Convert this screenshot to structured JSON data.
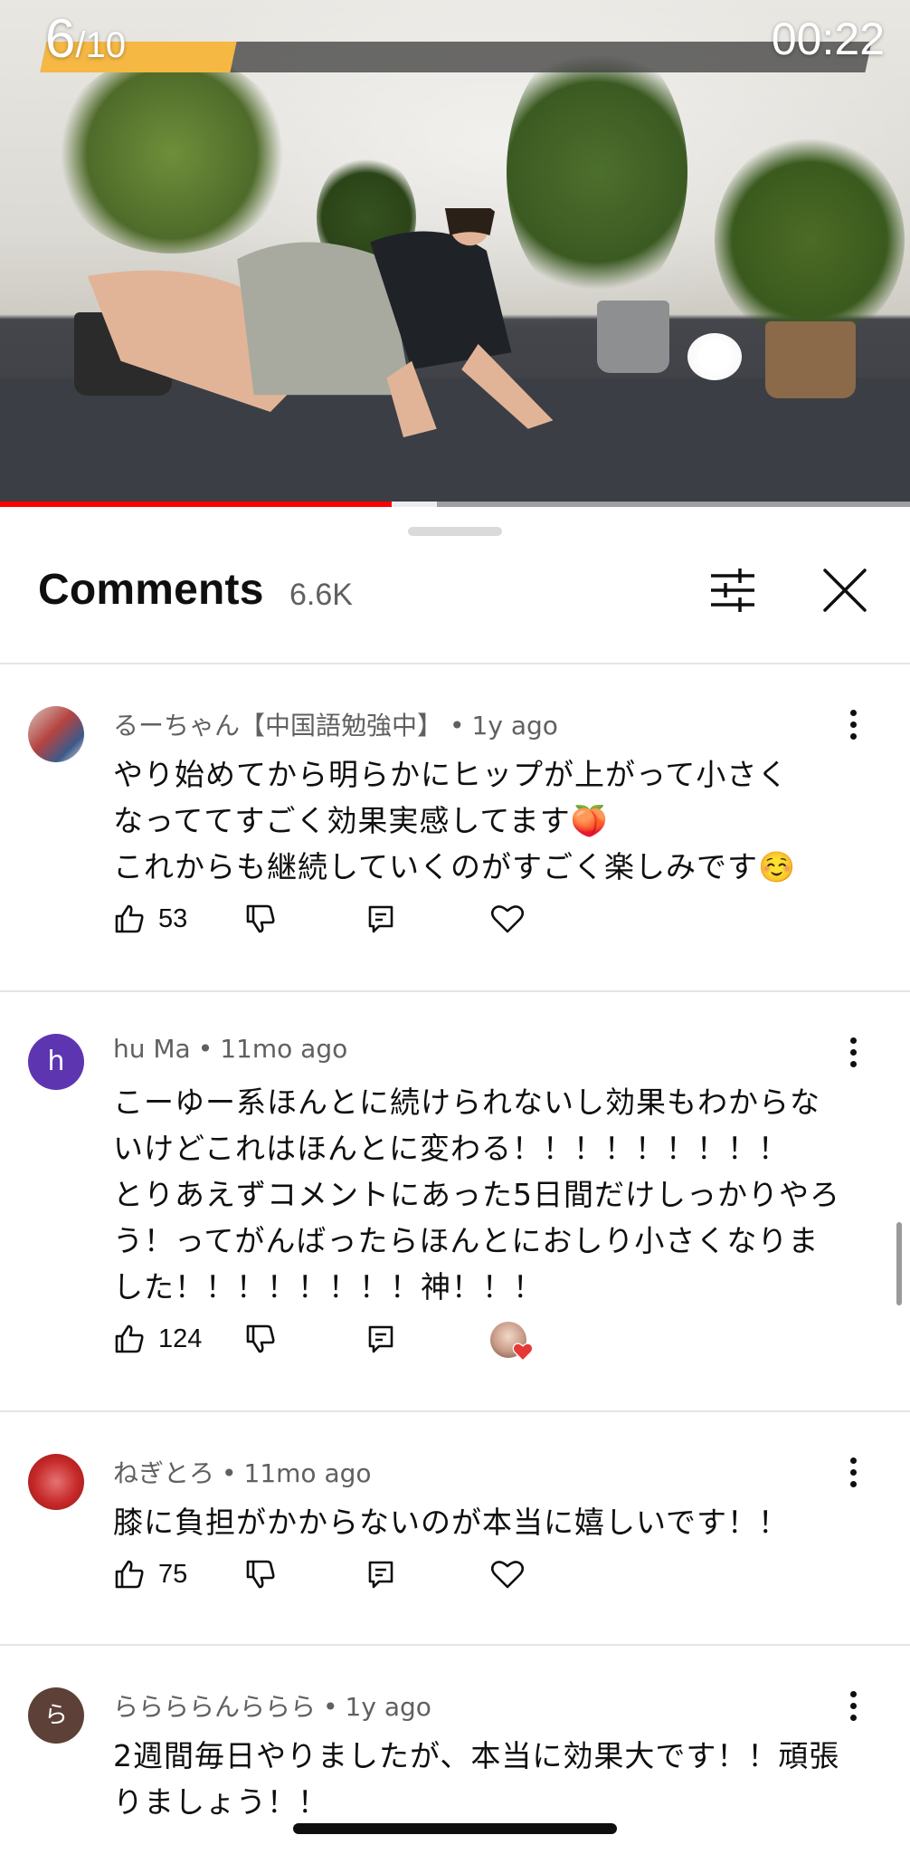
{
  "video": {
    "set_current": "6",
    "set_total": "/10",
    "timer": "00:22",
    "set_progress_fraction": 0.23,
    "playback_progress_fraction": 0.43,
    "buffered_fraction": 0.05
  },
  "sheet": {
    "title": "Comments",
    "count": "6.6K"
  },
  "comments": [
    {
      "author": "るーちゃん【中国語勉強中】",
      "time": "1y ago",
      "lines": [
        "やり始めてから明らかにヒップが上がって小さく",
        "なっててすごく効果実感してます🍑",
        "これからも継続していくのがすごく楽しみです☺️"
      ],
      "likes": "53",
      "avatar_color": "#8a6b6b",
      "avatar_letter": "",
      "creator_hearted": false
    },
    {
      "author": "hu Ma",
      "time": "11mo ago",
      "lines": [
        "こーゆー系ほんとに続けられないし効果もわからな",
        "いけどこれはほんとに変わる！！！！！！！！！",
        "とりあえずコメントにあった5日間だけしっかりやろ",
        "う！ってがんばったらほんとにおしり小さくなりま",
        "した！！！！！！！！神！！！"
      ],
      "likes": "124",
      "avatar_color": "#5e35b1",
      "avatar_letter": "h",
      "creator_hearted": true
    },
    {
      "author": "ねぎとろ",
      "time": "11mo ago",
      "lines": [
        "膝に負担がかからないのが本当に嬉しいです！！"
      ],
      "likes": "75",
      "avatar_color": "#c62828",
      "avatar_letter": "",
      "creator_hearted": false
    },
    {
      "author": "ららららんららら",
      "time": "1y ago",
      "lines": [
        "2週間毎日やりましたが、本当に効果大です！！頑張",
        "りましょう！！"
      ],
      "likes": "",
      "avatar_color": "#5d4037",
      "avatar_letter": "ら",
      "creator_hearted": false
    }
  ],
  "icons": {
    "filter": "sliders-icon",
    "close": "close-icon",
    "like": "thumbs-up-icon",
    "dislike": "thumbs-down-icon",
    "reply": "reply-icon",
    "heart": "heart-icon",
    "more": "more-vertical-icon"
  },
  "colors": {
    "set_bar_fill": "#f5b843",
    "playback_red": "#ff0000",
    "creator_heart": "#e53935"
  }
}
